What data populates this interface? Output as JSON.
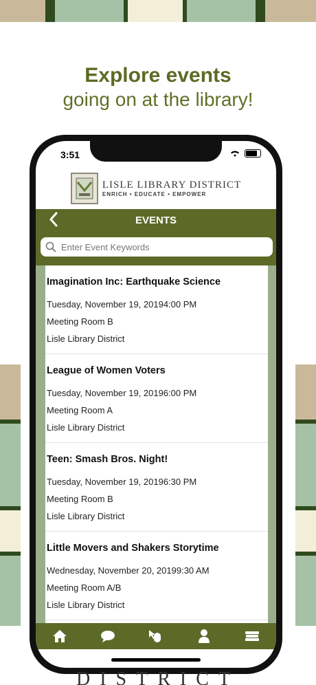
{
  "headline": {
    "line1": "Explore events",
    "line2": "going on at the library!"
  },
  "status_bar": {
    "time": "3:51"
  },
  "logo": {
    "name": "LISLE LIBRARY DISTRICT",
    "tagline": "ENRICH • EDUCATE • EMPOWER"
  },
  "nav": {
    "title": "EVENTS",
    "back_icon": "chevron-left-icon"
  },
  "search": {
    "placeholder": "Enter Event Keywords",
    "icon": "search-icon"
  },
  "events": [
    {
      "title": "Imagination Inc: Earthquake Science",
      "datetime": "Tuesday, November 19, 20194:00 PM",
      "room": "Meeting Room B",
      "location": "Lisle Library District"
    },
    {
      "title": "League of Women Voters",
      "datetime": "Tuesday, November 19, 20196:00 PM",
      "room": "Meeting Room A",
      "location": "Lisle Library District"
    },
    {
      "title": "Teen: Smash Bros. Night!",
      "datetime": "Tuesday, November 19, 20196:30 PM",
      "room": "Meeting Room B",
      "location": "Lisle Library District"
    },
    {
      "title": "Little Movers and Shakers Storytime",
      "datetime": "Wednesday, November 20, 20199:30 AM",
      "room": "Meeting Room A/B",
      "location": "Lisle Library District"
    }
  ],
  "tabs": [
    {
      "icon": "home-icon"
    },
    {
      "icon": "chat-bubble-icon"
    },
    {
      "icon": "mouse-pointer-icon"
    },
    {
      "icon": "person-icon"
    },
    {
      "icon": "books-icon"
    }
  ],
  "bottom_text": "DISTRICT",
  "colors": {
    "brand_green": "#5c6a28",
    "headline_green": "#5b6b25",
    "list_border": "#9aae8c"
  }
}
